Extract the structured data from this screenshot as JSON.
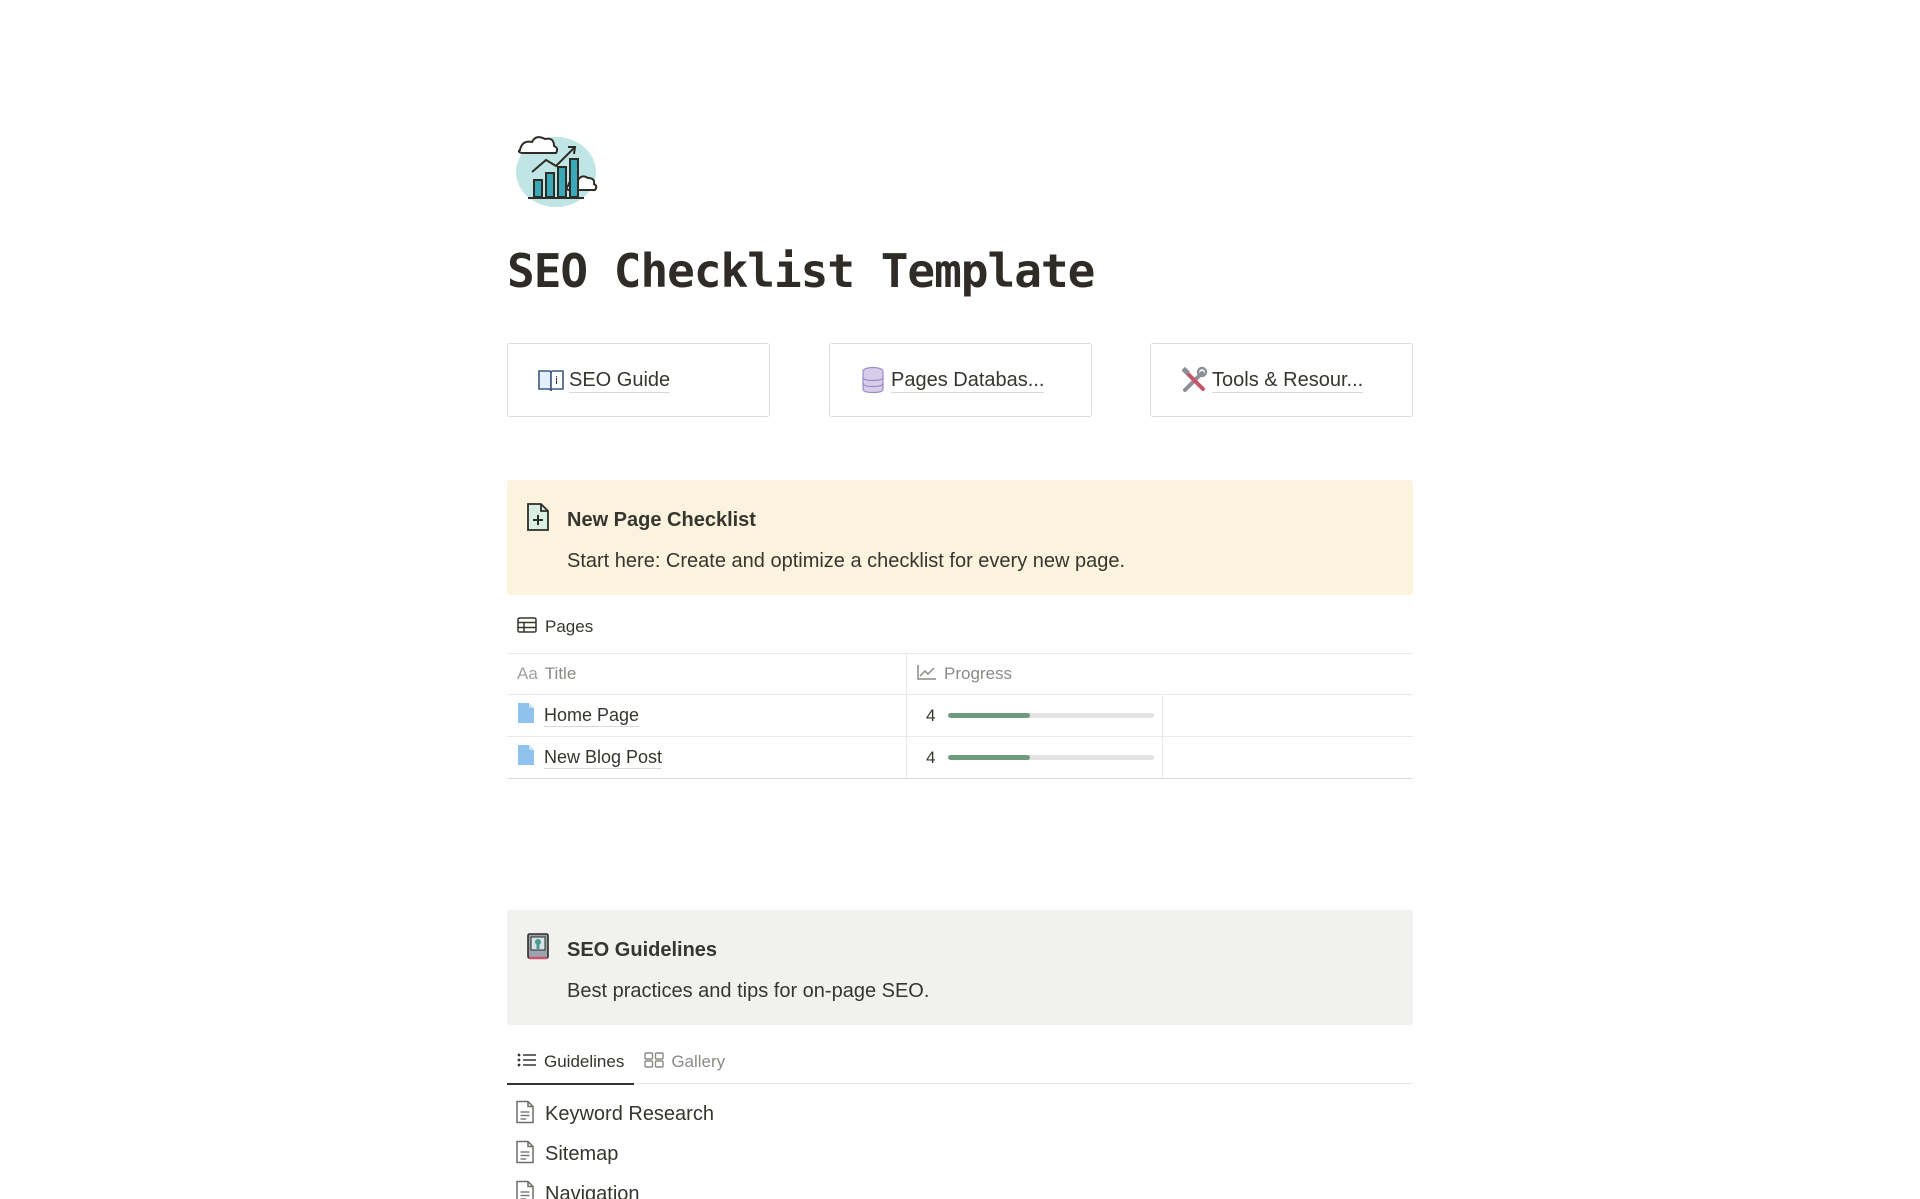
{
  "page": {
    "icon": "bar-chart-with-clouds-icon",
    "title": "SEO Checklist Template"
  },
  "links": [
    {
      "icon": "open-book-icon",
      "label": "SEO Guide"
    },
    {
      "icon": "database-icon",
      "label": "Pages Databas..."
    },
    {
      "icon": "tools-icon",
      "label": "Tools & Resour..."
    }
  ],
  "callout_new_page": {
    "icon": "page-add-icon",
    "title": "New Page Checklist",
    "text": "Start here: Create and optimize a checklist for every new page."
  },
  "pages_db": {
    "view_icon": "table-icon",
    "view_label": "Pages",
    "columns": [
      {
        "icon": "text-property-icon",
        "icon_text": "Aa",
        "label": "Title"
      },
      {
        "icon": "trend-chart-icon",
        "label": "Progress"
      }
    ],
    "rows": [
      {
        "icon": "blue-page-icon",
        "title": "Home Page",
        "progress": "4",
        "progress_fraction": 0.4
      },
      {
        "icon": "blue-page-icon",
        "title": "New Blog Post",
        "progress": "4",
        "progress_fraction": 0.4
      }
    ],
    "progress_color": "#6d9b7e"
  },
  "callout_guidelines": {
    "icon": "guidebook-icon",
    "title": "SEO Guidelines",
    "text": "Best practices and tips for on-page SEO."
  },
  "guidelines_tabs": [
    {
      "icon": "list-icon",
      "label": "Guidelines",
      "active": true
    },
    {
      "icon": "gallery-icon",
      "label": "Gallery",
      "active": false
    }
  ],
  "guidelines_list": [
    {
      "icon": "document-icon",
      "label": "Keyword Research"
    },
    {
      "icon": "document-icon",
      "label": "Sitemap"
    },
    {
      "icon": "document-icon",
      "label": "Navigation"
    }
  ],
  "colors": {
    "callout_yellow": "#fbf3dd",
    "callout_gray": "#f1f1ef",
    "text": "#37352f"
  }
}
